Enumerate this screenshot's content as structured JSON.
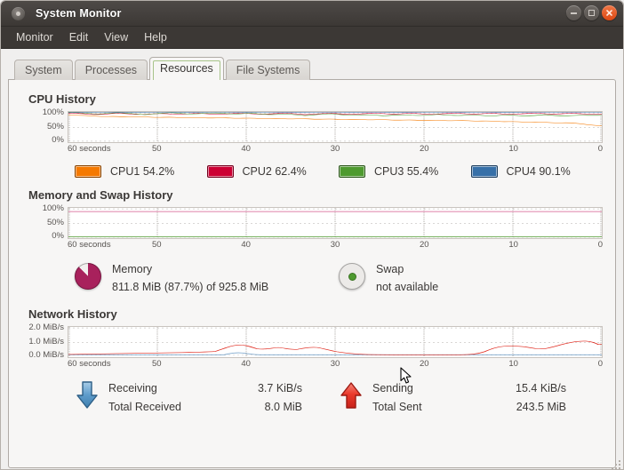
{
  "window": {
    "title": "System Monitor",
    "app_icon": "system-monitor-icon",
    "buttons": {
      "minimize": "minimize",
      "maximize": "maximize",
      "close": "close"
    }
  },
  "menubar": {
    "items": [
      "Monitor",
      "Edit",
      "View",
      "Help"
    ]
  },
  "tabs": [
    {
      "label": "System",
      "active": false
    },
    {
      "label": "Processes",
      "active": false
    },
    {
      "label": "Resources",
      "active": true
    },
    {
      "label": "File Systems",
      "active": false
    }
  ],
  "sections": {
    "cpu": {
      "title": "CPU History"
    },
    "memory": {
      "title": "Memory and Swap History"
    },
    "network": {
      "title": "Network History"
    }
  },
  "cpu_legend": [
    {
      "name": "CPU1",
      "value": "54.2%",
      "label": "CPU1 54.2%",
      "color": "#f57900"
    },
    {
      "name": "CPU2",
      "value": "62.4%",
      "label": "CPU2 62.4%",
      "color": "#cc0033"
    },
    {
      "name": "CPU3",
      "value": "55.4%",
      "label": "CPU3 55.4%",
      "color": "#4e9a2f"
    },
    {
      "name": "CPU4",
      "value": "90.1%",
      "label": "CPU4 90.1%",
      "color": "#3770a8"
    }
  ],
  "memory_legend": {
    "memory": {
      "name": "Memory",
      "value": "811.8 MiB (87.7%) of 925.8 MiB",
      "used_mib": 811.8,
      "percent": 87.7,
      "total_mib": 925.8,
      "color": "#a8215c"
    },
    "swap": {
      "name": "Swap",
      "value": "not available",
      "percent": 0,
      "color": "#4e9a2f"
    }
  },
  "network_legend": {
    "receiving": {
      "name": "Receiving",
      "rate": "3.7 KiB/s",
      "total_label": "Total Received",
      "total": "8.0 MiB",
      "icon": "down-arrow-icon",
      "color": "#3770a8"
    },
    "sending": {
      "name": "Sending",
      "rate": "15.4 KiB/s",
      "total_label": "Total Sent",
      "total": "243.5 MiB",
      "icon": "up-arrow-icon",
      "color": "#e02b20"
    }
  },
  "chart_data": [
    {
      "type": "line",
      "id": "cpu-history",
      "title": "CPU History",
      "xlabel": "",
      "ylabel": "",
      "x_ticks": [
        "60 seconds",
        "50",
        "40",
        "30",
        "20",
        "10",
        "0"
      ],
      "y_ticks": [
        "100%",
        "50%",
        "0%"
      ],
      "ylim": [
        0,
        100
      ],
      "grid": true,
      "legend_position": "bottom",
      "series": [
        {
          "name": "CPU1",
          "color": "#f57900",
          "values": [
            93,
            90,
            92,
            88,
            90,
            91,
            89,
            87,
            90,
            92,
            89,
            86,
            88,
            90,
            87,
            85,
            88,
            90,
            92,
            88,
            86,
            89,
            91,
            88,
            85,
            87,
            90,
            88,
            86,
            84,
            87,
            89,
            86,
            84,
            86,
            88,
            85,
            83,
            86,
            88,
            90,
            87,
            84,
            86,
            88,
            85,
            82,
            84,
            86,
            83,
            80,
            82,
            84,
            81,
            78,
            80,
            82,
            79,
            70,
            62,
            54
          ]
        },
        {
          "name": "CPU2",
          "color": "#cc0033",
          "values": [
            97,
            99,
            96,
            94,
            97,
            99,
            96,
            93,
            95,
            98,
            96,
            93,
            95,
            97,
            94,
            92,
            95,
            98,
            96,
            93,
            96,
            98,
            95,
            93,
            96,
            98,
            95,
            92,
            95,
            97,
            94,
            92,
            95,
            97,
            94,
            92,
            95,
            97,
            95,
            92,
            95,
            98,
            96,
            93,
            96,
            98,
            95,
            93,
            96,
            98,
            95,
            93,
            96,
            98,
            95,
            93,
            96,
            98,
            95,
            92,
            93
          ]
        },
        {
          "name": "CPU3",
          "color": "#4e9a2f",
          "values": [
            99,
            100,
            98,
            95,
            97,
            100,
            98,
            95,
            97,
            99,
            96,
            93,
            96,
            99,
            97,
            94,
            96,
            99,
            97,
            94,
            96,
            98,
            95,
            92,
            94,
            97,
            95,
            92,
            90,
            93,
            96,
            94,
            91,
            89,
            92,
            95,
            93,
            90,
            88,
            91,
            94,
            92,
            89,
            91,
            94,
            92,
            89,
            91,
            94,
            92,
            89,
            87,
            90,
            93,
            91,
            88,
            90,
            93,
            91,
            88,
            90
          ]
        },
        {
          "name": "CPU4",
          "color": "#3770a8",
          "values": [
            100,
            100,
            100,
            100,
            100,
            100,
            100,
            100,
            99,
            100,
            100,
            100,
            99,
            100,
            100,
            100,
            99,
            100,
            100,
            100,
            100,
            100,
            100,
            99,
            100,
            100,
            100,
            99,
            100,
            100,
            100,
            100,
            99,
            100,
            100,
            100,
            100,
            99,
            100,
            100,
            100,
            100,
            99,
            100,
            100,
            100,
            100,
            100,
            99,
            100,
            100,
            100,
            100,
            100,
            100,
            100,
            100,
            100,
            100,
            100,
            100
          ]
        }
      ]
    },
    {
      "type": "line",
      "id": "memory-swap-history",
      "title": "Memory and Swap History",
      "xlabel": "",
      "ylabel": "",
      "x_ticks": [
        "60 seconds",
        "50",
        "40",
        "30",
        "20",
        "10",
        "0"
      ],
      "y_ticks": [
        "100%",
        "50%",
        "0%"
      ],
      "ylim": [
        0,
        100
      ],
      "grid": true,
      "legend_position": "bottom",
      "series": [
        {
          "name": "Memory",
          "color": "#d4588c",
          "constant": 88,
          "values": [
            88,
            88,
            88,
            88,
            88,
            88,
            88,
            88,
            88,
            88,
            88,
            88,
            88,
            88,
            88,
            88,
            88,
            88,
            88,
            88,
            88,
            88,
            88,
            88,
            88,
            88,
            88,
            88,
            88,
            88,
            88,
            88,
            88,
            88,
            88,
            88,
            88,
            88,
            88,
            88,
            88,
            88,
            88,
            88,
            88,
            88,
            88,
            88,
            88,
            88,
            88,
            88,
            88,
            88,
            88,
            88,
            88,
            88,
            88,
            88,
            88
          ]
        },
        {
          "name": "Swap",
          "color": "#4e9a2f",
          "constant": 0,
          "values": [
            0,
            0,
            0,
            0,
            0,
            0,
            0,
            0,
            0,
            0,
            0,
            0,
            0,
            0,
            0,
            0,
            0,
            0,
            0,
            0,
            0,
            0,
            0,
            0,
            0,
            0,
            0,
            0,
            0,
            0,
            0,
            0,
            0,
            0,
            0,
            0,
            0,
            0,
            0,
            0,
            0,
            0,
            0,
            0,
            0,
            0,
            0,
            0,
            0,
            0,
            0,
            0,
            0,
            0,
            0,
            0,
            0,
            0,
            0,
            0,
            0
          ]
        }
      ]
    },
    {
      "type": "line",
      "id": "network-history",
      "title": "Network History",
      "xlabel": "",
      "ylabel": "",
      "x_ticks": [
        "60 seconds",
        "50",
        "40",
        "30",
        "20",
        "10",
        "0"
      ],
      "y_ticks": [
        "2.0 MiB/s",
        "1.0 MiB/s",
        "0.0 MiB/s"
      ],
      "ylim": [
        0,
        2
      ],
      "y_unit": "MiB/s",
      "grid": true,
      "legend_position": "bottom",
      "series": [
        {
          "name": "Sending",
          "color": "#e02b20",
          "values": [
            0.02,
            0.02,
            0.03,
            0.03,
            0.04,
            0.05,
            0.05,
            0.06,
            0.06,
            0.07,
            0.07,
            0.08,
            0.08,
            0.08,
            0.09,
            0.09,
            0.1,
            0.12,
            0.18,
            0.26,
            0.3,
            0.26,
            0.2,
            0.17,
            0.2,
            0.24,
            0.22,
            0.18,
            0.16,
            0.2,
            0.24,
            0.21,
            0.17,
            0.14,
            0.11,
            0.08,
            0.05,
            0.04,
            0.04,
            0.04,
            0.04,
            0.04,
            0.04,
            0.04,
            0.05,
            0.1,
            0.22,
            0.3,
            0.32,
            0.31,
            0.28,
            0.23,
            0.21,
            0.25,
            0.3,
            0.38,
            0.46,
            0.48,
            0.44,
            0.36,
            0.35
          ]
        },
        {
          "name": "Receiving",
          "color": "#3770a8",
          "values": [
            0.02,
            0.02,
            0.02,
            0.02,
            0.02,
            0.02,
            0.02,
            0.02,
            0.02,
            0.02,
            0.02,
            0.02,
            0.02,
            0.02,
            0.02,
            0.02,
            0.02,
            0.02,
            0.03,
            0.06,
            0.08,
            0.06,
            0.03,
            0.02,
            0.02,
            0.02,
            0.02,
            0.02,
            0.02,
            0.02,
            0.02,
            0.02,
            0.02,
            0.02,
            0.02,
            0.02,
            0.02,
            0.02,
            0.02,
            0.02,
            0.02,
            0.02,
            0.02,
            0.02,
            0.02,
            0.02,
            0.02,
            0.02,
            0.02,
            0.02,
            0.02,
            0.02,
            0.02,
            0.02,
            0.02,
            0.02,
            0.02,
            0.02,
            0.02,
            0.02,
            0.02
          ]
        }
      ]
    }
  ]
}
